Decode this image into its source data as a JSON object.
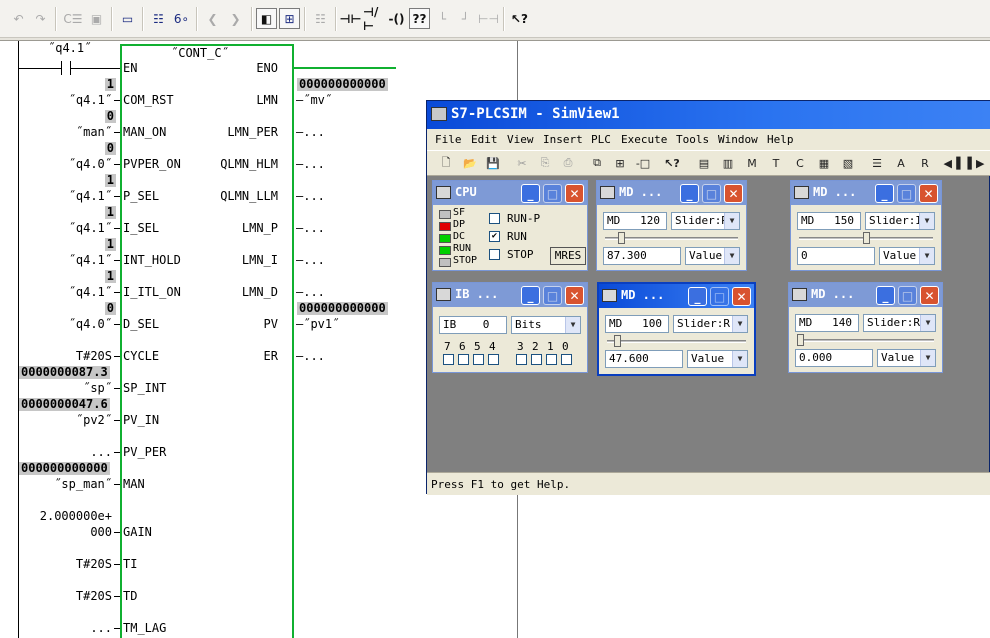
{
  "colors": {
    "block_border": "#10b030",
    "badge_bg": "#c6c6c6",
    "led_off": "#c0c0c0",
    "led_red": "#e00000",
    "led_green": "#00d000",
    "title_active": "#0a4ad8"
  },
  "toolbar": {
    "icons": [
      "undo-icon",
      "redo-icon",
      "compile-icon",
      "download-icon",
      "monitor-icon",
      "network-icon",
      "eyeglasses-icon",
      "prev-network-icon",
      "next-network-icon",
      "overview-icon",
      "zoom-icon",
      "insert-network-icon",
      "no-contact-icon",
      "nc-contact-icon",
      "coil-icon",
      "box-icon",
      "branch-open-icon",
      "branch-close-icon",
      "connection-icon",
      "help-pointer-icon"
    ]
  },
  "ladder": {
    "contact_label": "˝q4.1˝",
    "block_name": "˝CONT_C˝",
    "inputs": [
      {
        "pin": "EN",
        "label": "",
        "badge": ""
      },
      {
        "pin": "COM_RST",
        "label": "˝q4.1˝",
        "badge": "1"
      },
      {
        "pin": "MAN_ON",
        "label": "˝man˝",
        "badge": "0"
      },
      {
        "pin": "PVPER_ON",
        "label": "˝q4.0˝",
        "badge": "0"
      },
      {
        "pin": "P_SEL",
        "label": "˝q4.1˝",
        "badge": "1"
      },
      {
        "pin": "I_SEL",
        "label": "˝q4.1˝",
        "badge": "1"
      },
      {
        "pin": "INT_HOLD",
        "label": "˝q4.1˝",
        "badge": "1"
      },
      {
        "pin": "I_ITL_ON",
        "label": "˝q4.1˝",
        "badge": "1"
      },
      {
        "pin": "D_SEL",
        "label": "˝q4.0˝",
        "badge": "0"
      },
      {
        "pin": "CYCLE",
        "label": "T#20S",
        "badge": ""
      },
      {
        "pin": "SP_INT",
        "label": "˝sp˝",
        "badge": "0000000087.3"
      },
      {
        "pin": "PV_IN",
        "label": "˝pv2˝",
        "badge": "0000000047.6"
      },
      {
        "pin": "PV_PER",
        "label": "...",
        "badge": ""
      },
      {
        "pin": "MAN",
        "label": "˝sp_man˝",
        "badge": "000000000000"
      },
      {
        "pin": "GAIN",
        "label": "000",
        "badge": "",
        "label_top": "2.000000e+"
      },
      {
        "pin": "TI",
        "label": "T#20S",
        "badge": ""
      },
      {
        "pin": "TD",
        "label": "T#20S",
        "badge": ""
      },
      {
        "pin": "TM_LAG",
        "label": "...",
        "badge": ""
      }
    ],
    "outputs": [
      {
        "pin": "ENO",
        "label": "",
        "badge": ""
      },
      {
        "pin": "LMN",
        "label": "˝mv˝",
        "badge": "000000000000"
      },
      {
        "pin": "LMN_PER",
        "label": "...",
        "badge": ""
      },
      {
        "pin": "QLMN_HLM",
        "label": "...",
        "badge": ""
      },
      {
        "pin": "QLMN_LLM",
        "label": "...",
        "badge": ""
      },
      {
        "pin": "LMN_P",
        "label": "...",
        "badge": ""
      },
      {
        "pin": "LMN_I",
        "label": "...",
        "badge": ""
      },
      {
        "pin": "LMN_D",
        "label": "...",
        "badge": ""
      },
      {
        "pin": "PV",
        "label": "˝pv1˝",
        "badge": "000000000000"
      },
      {
        "pin": "ER",
        "label": "...",
        "badge": ""
      }
    ]
  },
  "sim": {
    "title": "S7-PLCSIM - SimView1",
    "menu": [
      "File",
      "Edit",
      "View",
      "Insert",
      "PLC",
      "Execute",
      "Tools",
      "Window",
      "Help"
    ],
    "tool_icons": [
      "new-icon",
      "open-icon",
      "save-icon",
      "cut-icon",
      "copy-icon",
      "paste-icon",
      "cascade-icon",
      "tile-icon",
      "pin-icon",
      "help-pointer-icon",
      "insert-input-icon",
      "insert-output-icon",
      "insert-bit-memory-icon",
      "insert-timer-icon",
      "insert-counter-icon",
      "insert-generic-icon",
      "insert-vertical-bits-icon",
      "insert-stack-icon",
      "insert-accumulators-icon",
      "insert-block-regs-icon",
      "step-left-icon",
      "step-right-icon"
    ],
    "status": "Press F1 to get Help.",
    "cpu": {
      "title": "CPU",
      "leds": [
        {
          "name": "SF",
          "state": "off"
        },
        {
          "name": "DP",
          "state": "red"
        },
        {
          "name": "DC",
          "state": "green"
        },
        {
          "name": "RUN",
          "state": "green"
        },
        {
          "name": "STOP",
          "state": "off"
        }
      ],
      "modes": [
        {
          "label": "RUN-P",
          "checked": false
        },
        {
          "label": "RUN",
          "checked": true
        },
        {
          "label": "STOP",
          "checked": false
        }
      ],
      "mres": "MRES"
    },
    "md_windows": [
      {
        "id": "md120",
        "title": "MD   ...",
        "area": "MD",
        "addr": "120",
        "mode": "Slider:R",
        "value": "87.300",
        "format": "Value",
        "slider": 0.1,
        "active": false
      },
      {
        "id": "md150",
        "title": "MD   ...",
        "area": "MD",
        "addr": "150",
        "mode": "Slider:I",
        "value": "0",
        "format": "Value",
        "slider": 0.5,
        "active": false
      },
      {
        "id": "md100",
        "title": "MD   ...",
        "area": "MD",
        "addr": "100",
        "mode": "Slider:R",
        "value": "47.600",
        "format": "Value",
        "slider": 0.05,
        "active": true
      },
      {
        "id": "md140",
        "title": "MD   ...",
        "area": "MD",
        "addr": "140",
        "mode": "Slider:R",
        "value": "0.000",
        "format": "Value",
        "slider": 0.0,
        "active": false
      }
    ],
    "ib": {
      "title": "IB   ...",
      "area": "IB",
      "addr": "0",
      "format": "Bits",
      "bits": [
        "7",
        "6",
        "5",
        "4",
        "3",
        "2",
        "1",
        "0"
      ]
    }
  }
}
